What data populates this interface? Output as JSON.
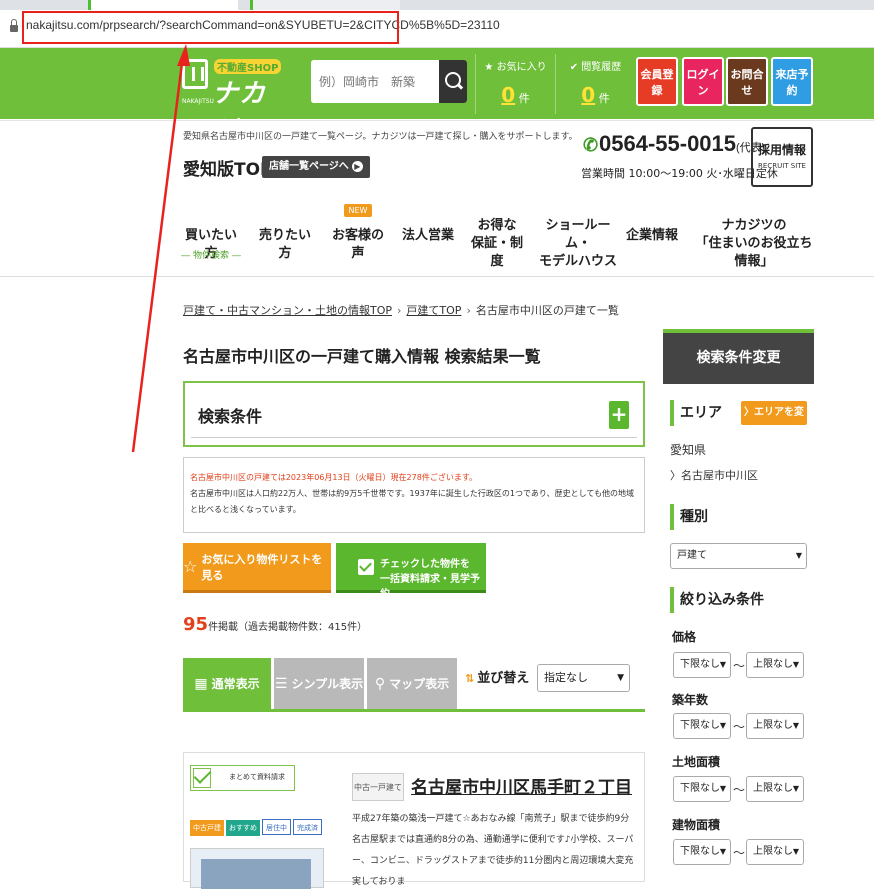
{
  "browser": {
    "url": "nakajitsu.com/prpsearch/?searchCommand=on&SYUBETU=2&CITYCD%5B%5D=23110"
  },
  "header": {
    "logo": {
      "tag": "不動産SHOP",
      "name": "ナカジツ",
      "sub": "NAKAJITSU"
    },
    "search_placeholder": "例）岡崎市　新築",
    "favorites": {
      "label": "お気に入り",
      "count": "0",
      "unit": "件"
    },
    "history": {
      "label": "閲覧履歴",
      "count": "0",
      "unit": "件"
    },
    "buttons": [
      {
        "label": "会員登録",
        "color": "#e63b25"
      },
      {
        "label": "ログイン",
        "color": "#e8255f"
      },
      {
        "label": "お問合せ",
        "color": "#6b3a1e"
      },
      {
        "label": "来店予約",
        "color": "#2f9de3"
      }
    ]
  },
  "infobar": {
    "description": "愛知県名古屋市中川区の一戸建て一覧ページ。ナカジツは一戸建て探し・購入をサポートします。",
    "region": "愛知版TOP",
    "shops_link": "店舗一覧ページへ",
    "phone": "0564-55-0015",
    "phone_suffix": "(代表)",
    "hours": "営業時間 10:00～19:00 火･水曜日定休",
    "recruit": {
      "title": "採用情報",
      "sub": "RECRUIT SITE"
    }
  },
  "nav": [
    {
      "label": "買いたい方",
      "sub": "― 物件検索 ―"
    },
    {
      "label": "売りたい方",
      "chev": "⌵"
    },
    {
      "label": "お客様の声",
      "new": "NEW",
      "chev": "⌵"
    },
    {
      "label": "法人営業"
    },
    {
      "label": "お得な\n保証・制度",
      "chev": "⌵"
    },
    {
      "label": "ショールーム・\nモデルハウス"
    },
    {
      "label": "企業情報"
    },
    {
      "label": "ナカジツの\n「住まいのお役立ち情報」"
    }
  ],
  "breadcrumb": [
    "戸建て・中古マンション・土地の情報TOP",
    "戸建てTOP",
    "名古屋市中川区の戸建て一覧"
  ],
  "breadcrumb_sep": "›",
  "page_title": "名古屋市中川区の一戸建て購入情報 検索結果一覧",
  "conditions": {
    "title": "検索条件",
    "plus": "+"
  },
  "notice": {
    "line1": "名古屋市中川区の戸建ては2023年06月13日（火曜日）現在278件ございます。",
    "line2": "名古屋市中川区は人口約22万人、世帯は約9万5千世帯です。1937年に誕生した行政区の1つであり、歴史としても他の地域と比べると浅くなっています。"
  },
  "actions": {
    "favorites_button": "お気に入り物件リストを見る",
    "request_line1": "チェックした物件を",
    "request_line2": "一括資料請求・見学予約"
  },
  "results": {
    "count": "95",
    "suffix": "件掲載（過去掲載物件数：415件）"
  },
  "view_tabs": [
    {
      "label": "通常表示",
      "icon": "grid-icon"
    },
    {
      "label": "シンプル表示",
      "icon": "list-icon"
    },
    {
      "label": "マップ表示",
      "icon": "pin-icon"
    }
  ],
  "sort": {
    "label": "並び替え",
    "value": "指定なし"
  },
  "listing": {
    "bulk": "まとめて資料請求",
    "badges": [
      "中古戸建",
      "おすすめ",
      "居住中",
      "完成済"
    ],
    "type": "中古一戸建て",
    "title": "名古屋市中川区馬手町２丁目",
    "description": "平成27年築の築浅一戸建て☆あおなみ線「南荒子」駅まで徒歩約9分名古屋駅までは直通約8分の為、通勤通学に便利です♪小学校、スーパー、コンビニ、ドラッグストアまで徒歩約11分圏内と周辺環境大変充実しておりま"
  },
  "sidebar": {
    "header": "検索条件変更",
    "area": {
      "title": "エリア",
      "button": "エリアを変更",
      "pref": "愛知県",
      "city": "名古屋市中川区"
    },
    "type": {
      "title": "種別",
      "value": "戸建て"
    },
    "filters": {
      "title": "絞り込み条件",
      "groups": [
        {
          "label": "価格",
          "min": "下限なし",
          "max": "上限なし"
        },
        {
          "label": "築年数",
          "min": "下限なし",
          "max": "上限なし"
        },
        {
          "label": "土地面積",
          "min": "下限なし",
          "max": "上限なし"
        },
        {
          "label": "建物面積",
          "min": "下限なし",
          "max": "上限なし"
        }
      ],
      "tilde": "～"
    }
  },
  "colors": {
    "brand_green": "#6fbf3b",
    "accent_orange": "#f29a1b",
    "annotation_red": "#e8231e"
  }
}
